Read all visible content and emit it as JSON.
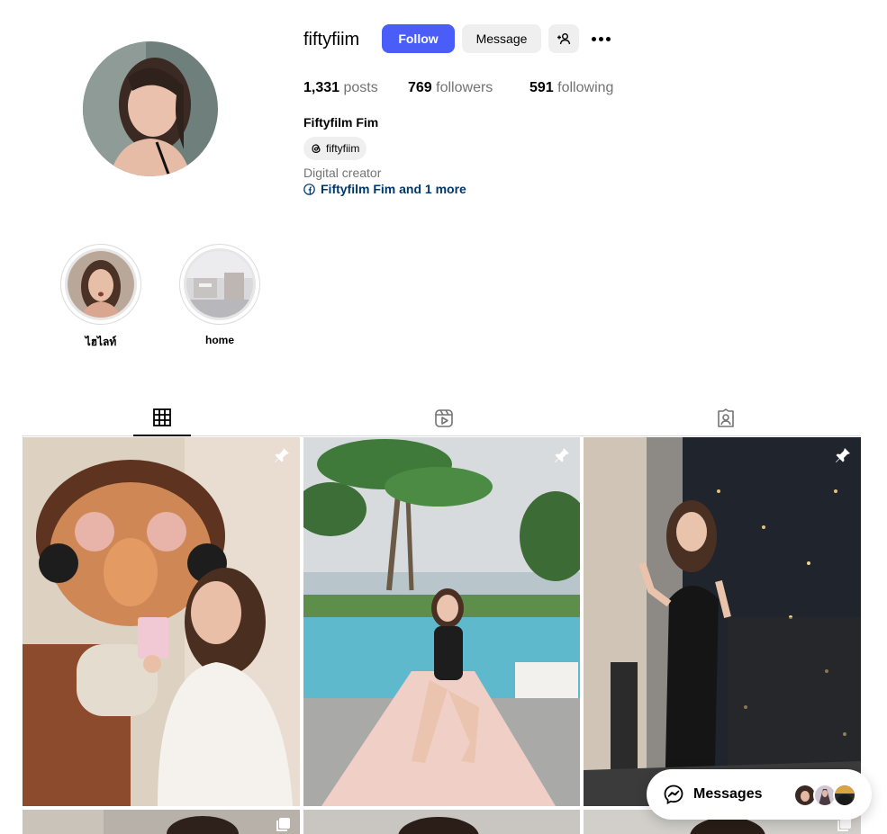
{
  "profile": {
    "username": "fiftyfiim",
    "follow_label": "Follow",
    "message_label": "Message",
    "stats": {
      "posts_count": "1,331",
      "posts_label": "posts",
      "followers_count": "769",
      "followers_label": "followers",
      "following_count": "591",
      "following_label": "following"
    },
    "full_name": "Fiftyfilm Fim",
    "threads_handle": "fiftyfiim",
    "category": "Digital creator",
    "linked_accounts": "Fiftyfilm Fim and 1 more"
  },
  "highlights": [
    {
      "label": "ไฮไลท์"
    },
    {
      "label": "home"
    }
  ],
  "tabs": [
    {
      "name": "posts",
      "icon": "grid-icon",
      "active": true
    },
    {
      "name": "reels",
      "icon": "reels-icon",
      "active": false
    },
    {
      "name": "tagged",
      "icon": "tagged-icon",
      "active": false
    }
  ],
  "messages": {
    "label": "Messages"
  },
  "colors": {
    "accent": "#4a5df9",
    "link": "#00376b",
    "muted": "#737373",
    "button_secondary": "#efefef"
  }
}
